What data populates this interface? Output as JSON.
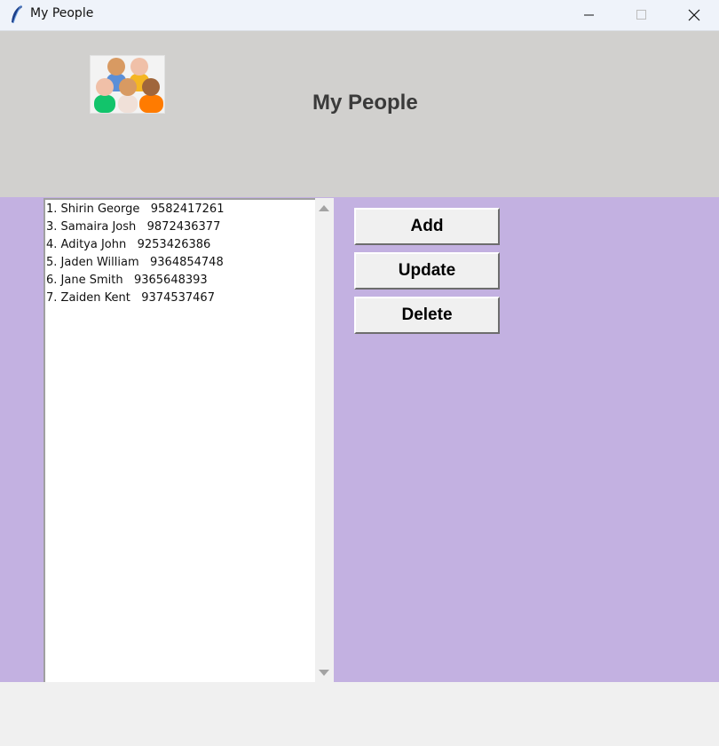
{
  "window": {
    "title": "My People"
  },
  "header": {
    "title": "My People",
    "logo_icon": "group-people-icon"
  },
  "contacts": [
    "1. Shirin George   9582417261",
    "3. Samaira Josh   9872436377",
    "4. Aditya John   9253426386",
    "5. Jaden William   9364854748",
    "6. Jane Smith   9365648393",
    "7. Zaiden Kent   9374537467"
  ],
  "buttons": {
    "add": "Add",
    "update": "Update",
    "delete": "Delete"
  },
  "colors": {
    "header_bg": "#d1d0ce",
    "main_bg": "#c3b1e1",
    "titlebar_bg": "#eff3fa"
  }
}
